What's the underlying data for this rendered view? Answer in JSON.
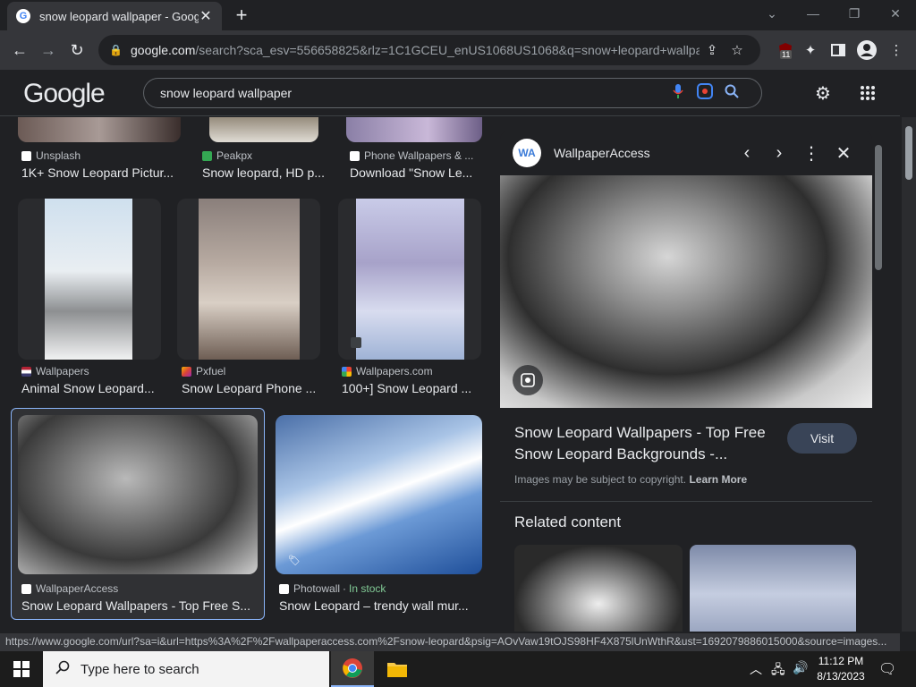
{
  "browser": {
    "tab_title": "snow leopard wallpaper - Google S",
    "url_domain": "google.com",
    "url_path": "/search?sca_esv=556658825&rlz=1C1GCEU_enUS1068US1068&q=snow+leopard+wallpa...",
    "extension_badge": "11"
  },
  "google": {
    "logo": "Google",
    "query": "snow leopard wallpaper"
  },
  "results": {
    "row1": [
      {
        "source": "Unsplash",
        "caption": "1K+ Snow Leopard Pictur..."
      },
      {
        "source": "Peakpx",
        "caption": "Snow leopard, HD p..."
      },
      {
        "source": "Phone Wallpapers & ...",
        "caption": "Download \"Snow Le..."
      }
    ],
    "row2": [
      {
        "source": "Wallpapers",
        "caption": "Animal Snow Leopard..."
      },
      {
        "source": "Pxfuel",
        "caption": "Snow Leopard Phone ..."
      },
      {
        "source": "Wallpapers.com",
        "caption": "100+] Snow Leopard ..."
      }
    ],
    "row3": [
      {
        "source": "WallpaperAccess",
        "caption": "Snow Leopard Wallpapers - Top Free S..."
      },
      {
        "source": "Photowall",
        "stock": "In stock",
        "caption": "Snow Leopard – trendy wall mur..."
      }
    ]
  },
  "panel": {
    "site_name": "WallpaperAccess",
    "title": "Snow Leopard Wallpapers - Top Free Snow Leopard Backgrounds -...",
    "visit_label": "Visit",
    "copyright_text": "Images may be subject to copyright.",
    "learn_more": "Learn More",
    "related_heading": "Related content"
  },
  "status_url": "https://www.google.com/url?sa=i&url=https%3A%2F%2Fwallpaperaccess.com%2Fsnow-leopard&psig=AOvVaw19tOJS98HF4X875lUnWthR&ust=1692079886015000&source=images...",
  "taskbar": {
    "search_placeholder": "Type here to search",
    "time": "11:12 PM",
    "date": "8/13/2023"
  }
}
